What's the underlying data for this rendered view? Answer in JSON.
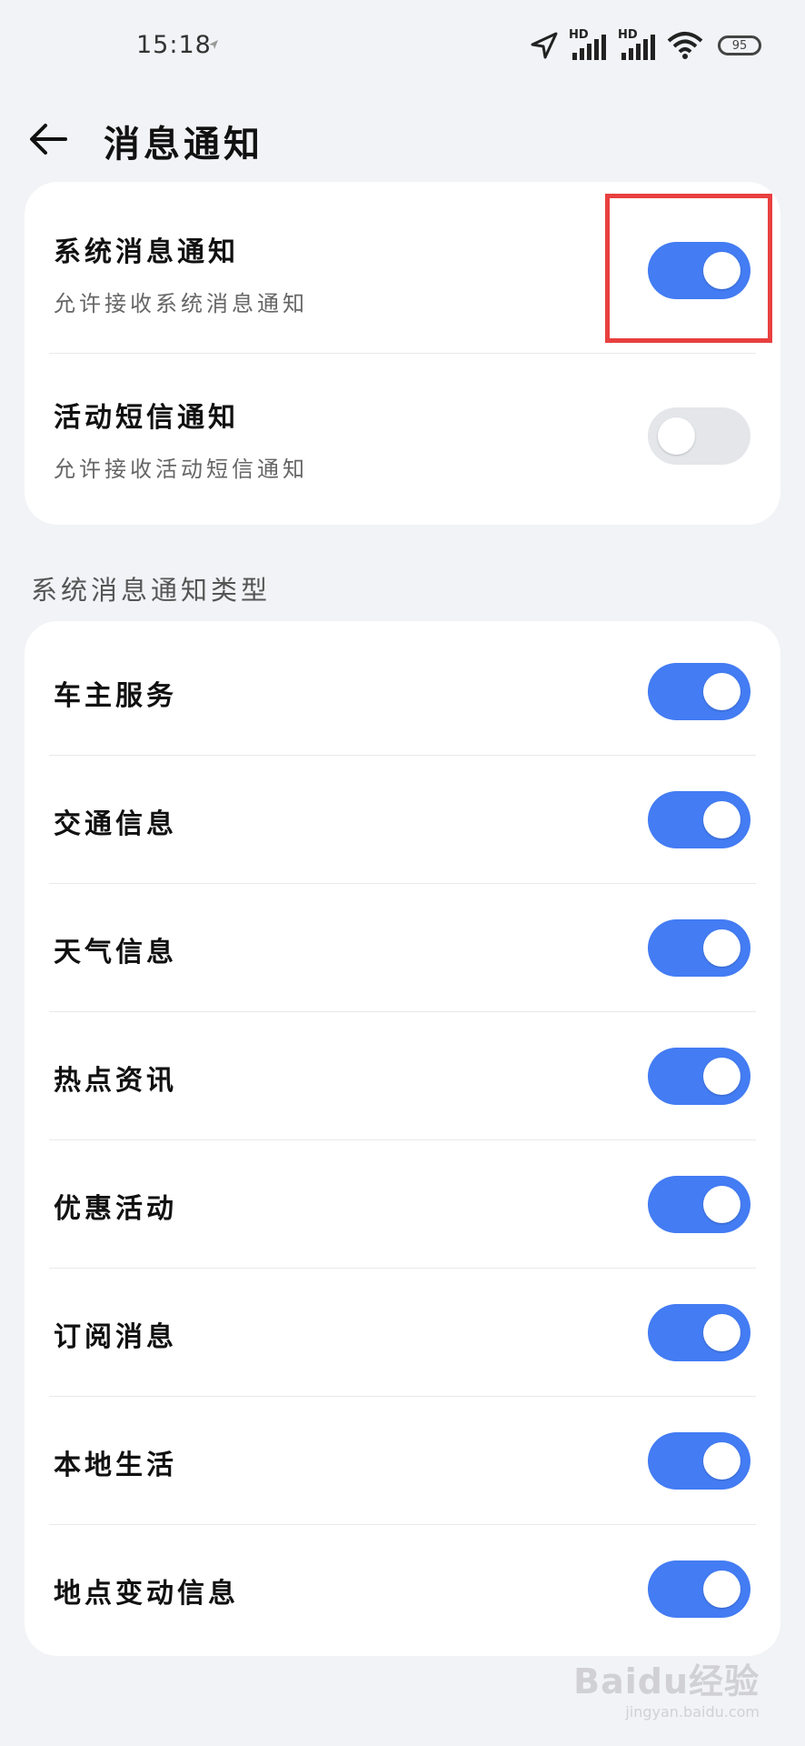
{
  "status_bar": {
    "time": "15:18",
    "hd_label_1": "HD",
    "hd_label_2": "HD",
    "battery": "95"
  },
  "header": {
    "title": "消息通知"
  },
  "top_card": {
    "items": [
      {
        "title": "系统消息通知",
        "subtitle": "允许接收系统消息通知",
        "enabled": true
      },
      {
        "title": "活动短信通知",
        "subtitle": "允许接收活动短信通知",
        "enabled": false
      }
    ]
  },
  "types_section": {
    "label": "系统消息通知类型",
    "items": [
      {
        "title": "车主服务",
        "enabled": true
      },
      {
        "title": "交通信息",
        "enabled": true
      },
      {
        "title": "天气信息",
        "enabled": true
      },
      {
        "title": "热点资讯",
        "enabled": true
      },
      {
        "title": "优惠活动",
        "enabled": true
      },
      {
        "title": "订阅消息",
        "enabled": true
      },
      {
        "title": "本地生活",
        "enabled": true
      },
      {
        "title": "地点变动信息",
        "enabled": true
      }
    ]
  },
  "colors": {
    "toggle_on": "#437cf3",
    "toggle_off": "#e4e6ea",
    "highlight": "#e8403f",
    "background": "#f2f3f6"
  },
  "watermark": {
    "main": "Baidu经验",
    "url": "jingyan.baidu.com"
  }
}
